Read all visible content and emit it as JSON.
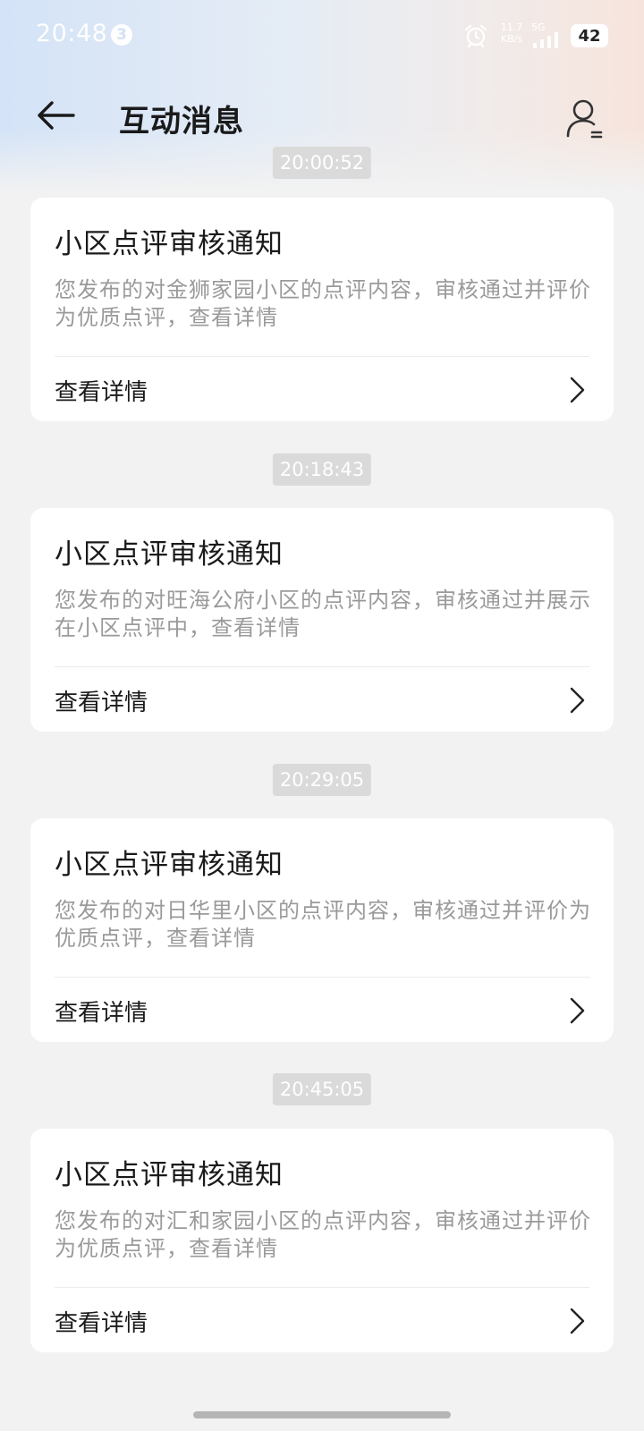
{
  "status_bar": {
    "time": "20:48",
    "notification_count": "3",
    "net_speed": "11.7",
    "net_speed_unit": "KB/s",
    "network_type": "5G",
    "battery": "42"
  },
  "header": {
    "title": "互动消息"
  },
  "messages": [
    {
      "time": "20:00:52",
      "title": "小区点评审核通知",
      "body": "您发布的对金狮家园小区的点评内容，审核通过并评价为优质点评，查看详情",
      "action": "查看详情"
    },
    {
      "time": "20:18:43",
      "title": "小区点评审核通知",
      "body": "您发布的对旺海公府小区的点评内容，审核通过并展示在小区点评中，查看详情",
      "action": "查看详情"
    },
    {
      "time": "20:29:05",
      "title": "小区点评审核通知",
      "body": "您发布的对日华里小区的点评内容，审核通过并评价为优质点评，查看详情",
      "action": "查看详情"
    },
    {
      "time": "20:45:05",
      "title": "小区点评审核通知",
      "body": "您发布的对汇和家园小区的点评内容，审核通过并评价为优质点评，查看详情",
      "action": "查看详情"
    }
  ]
}
